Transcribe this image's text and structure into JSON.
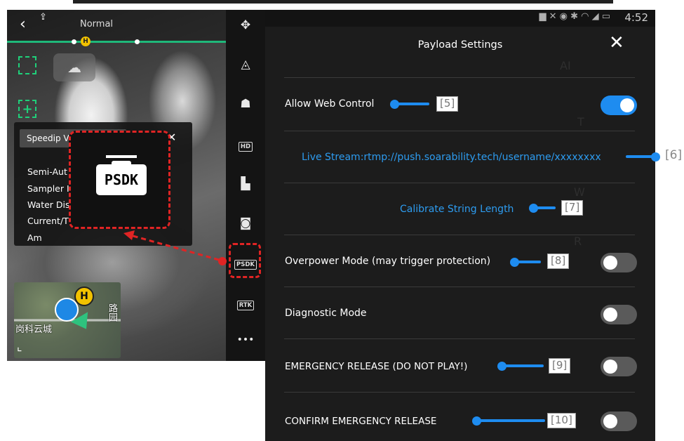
{
  "camera": {
    "mode_label": "Normal",
    "home_marker": "H"
  },
  "speedip": {
    "header": "Speedip V",
    "close": "✕",
    "rows": [
      "Semi-Aut",
      "Sampler I",
      "Water Dis",
      "Current/T",
      "Am"
    ]
  },
  "psdk_callout": {
    "icon_text": "PSDK"
  },
  "map": {
    "home_marker": "H",
    "place_label": "岗科云城",
    "street_label": "路园"
  },
  "rail": {
    "hd_badge": "HD",
    "psdk_badge": "PSDK",
    "rtk_badge": "RTK",
    "more": "•••"
  },
  "status_bar": {
    "time": "4:52"
  },
  "settings": {
    "title": "Payload Settings",
    "close": "✕",
    "allow_web_control": {
      "label": "Allow Web Control",
      "on": true
    },
    "live_stream": "Live Stream:rtmp://push.soarability.tech/username/xxxxxxxx",
    "calibrate": "Calibrate String Length",
    "overpower": {
      "label": "Overpower Mode (may trigger protection)",
      "on": false
    },
    "diagnostic": {
      "label": "Diagnostic Mode",
      "on": false
    },
    "emergency": {
      "label": "EMERGENCY RELEASE (DO NOT PLAY!)",
      "on": false
    },
    "confirm_emergency": {
      "label": "CONFIRM EMERGENCY RELEASE",
      "on": false
    }
  },
  "annotations": {
    "a5": "[5]",
    "a6": "[6]",
    "a7": "[7]",
    "a8": "[8]",
    "a9": "[9]",
    "a10": "[10]"
  },
  "colors": {
    "accent": "#1e8cf0",
    "link": "#2d9cf0",
    "callout_red": "#e02424",
    "panel_bg": "#1c1c1c"
  }
}
